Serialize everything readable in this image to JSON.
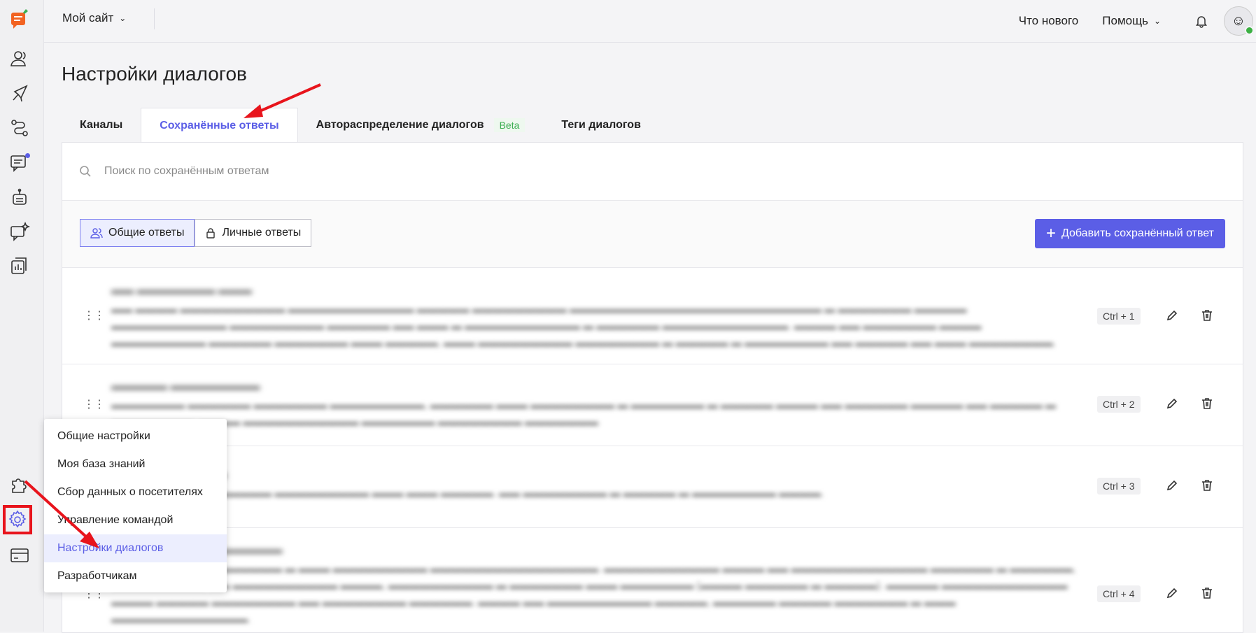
{
  "topbar": {
    "site": "Мой сайт",
    "whats_new": "Что нового",
    "help": "Помощь"
  },
  "page": {
    "title": "Настройки диалогов"
  },
  "tabs": [
    {
      "label": "Каналы"
    },
    {
      "label": "Сохранённые ответы",
      "active": true
    },
    {
      "label": "Автораспределение диалогов",
      "badge": "Beta"
    },
    {
      "label": "Теги диалогов"
    }
  ],
  "search": {
    "placeholder": "Поиск по сохранённым ответам"
  },
  "filters": {
    "general": "Общие ответы",
    "personal": "Личные ответы"
  },
  "add_button": "Добавить сохранённый ответ",
  "answers": [
    {
      "shortcut": "Ctrl + 1"
    },
    {
      "shortcut": "Ctrl + 2"
    },
    {
      "shortcut": "Ctrl + 3"
    },
    {
      "shortcut": "Ctrl + 4"
    }
  ],
  "settings_menu": [
    {
      "label": "Общие настройки"
    },
    {
      "label": "Моя база знаний"
    },
    {
      "label": "Сбор данных о посетителях"
    },
    {
      "label": "Управление командой"
    },
    {
      "label": "Настройки диалогов",
      "selected": true
    },
    {
      "label": "Разработчикам"
    }
  ],
  "colors": {
    "accent": "#5b5ee6",
    "highlight": "#e8141c",
    "beta": "#3cae52"
  }
}
